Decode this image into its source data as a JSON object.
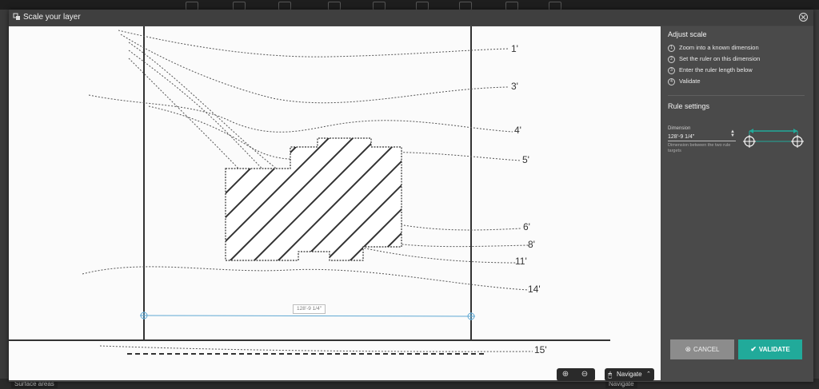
{
  "background": {
    "bottom_chip": "Surface areas",
    "bottom_nav_label": "Navigate"
  },
  "modal": {
    "title": "Scale your layer"
  },
  "drawing": {
    "contour_labels": [
      "1'",
      "3'",
      "4'",
      "5'",
      "6'",
      "8'",
      "11'",
      "14'",
      "15'"
    ],
    "ruler_value": "128'-9 1/4\""
  },
  "toolbar": {
    "navigate_label": "Navigate"
  },
  "panel": {
    "adjust_title": "Adjust scale",
    "steps": [
      {
        "num": "1",
        "label": "Zoom into a known dimension"
      },
      {
        "num": "2",
        "label": "Set the ruler on this dimension"
      },
      {
        "num": "3",
        "label": "Enter the ruler length below"
      },
      {
        "num": "4",
        "label": "Validate"
      }
    ],
    "rule_title": "Rule settings",
    "dimension_label": "Dimension",
    "dimension_value": "128'-9 1/4\"",
    "dimension_help": "Dimension between the two rule targets",
    "cancel_label": "CANCEL",
    "validate_label": "VALIDATE"
  },
  "colors": {
    "accent": "#21aa9a",
    "ruler": "#5fa8d3",
    "panel_bg": "#4a4a4a"
  }
}
